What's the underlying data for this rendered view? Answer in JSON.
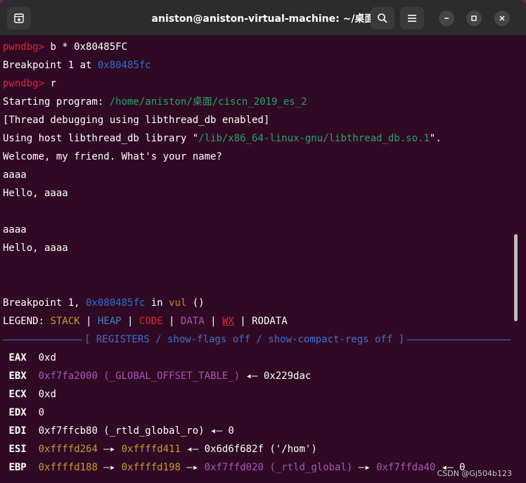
{
  "titlebar": {
    "title": "aniston@aniston-virtual-machine: ~/桌面"
  },
  "icons": {
    "new_tab": "new-tab-icon",
    "search": "search-icon",
    "menu": "hamburger-menu-icon",
    "minimize": "minimize-icon",
    "maximize": "maximize-icon",
    "close": "close-icon"
  },
  "lines": {
    "l1_prompt": "pwndbg>",
    "l1_cmd": " b * 0x80485FC",
    "l2_text": "Breakpoint 1 at ",
    "l2_addr": "0x80485fc",
    "l3_prompt": "pwndbg>",
    "l3_cmd": " r",
    "l4_text": "Starting program: ",
    "l4_path": "/home/aniston/桌面/ciscn_2019_es_2",
    "l5": "[Thread debugging using libthread_db enabled]",
    "l6_text": "Using host libthread_db library \"",
    "l6_path": "/lib/x86_64-linux-gnu/libthread_db.so.1",
    "l6_end": "\".",
    "l7": "Welcome, my friend. What's your name?",
    "l8": "aaaa",
    "l9": "Hello, aaaa",
    "l10": "",
    "l11": "aaaa",
    "l12": "Hello, aaaa",
    "l13": "",
    "l14": "",
    "l15_text": "Breakpoint 1, ",
    "l15_addr": "0x080485fc",
    "l15_in": " in ",
    "l15_func": "vul",
    "l15_end": " ()"
  },
  "legend": {
    "label": "LEGEND: ",
    "stack": "STACK",
    "heap": "HEAP",
    "code": "CODE",
    "data": "DATA",
    "wx": "WX",
    "rodata": "RODATA",
    "sep": " | "
  },
  "section": {
    "title": "[ REGISTERS / show-flags off / show-compact-regs off ]"
  },
  "registers": {
    "eax": {
      "name": "EAX",
      "value": "0xd"
    },
    "ebx": {
      "name": "EBX",
      "value": "0xf7fa2000 (_GLOBAL_OFFSET_TABLE_)",
      "arrow": " ◂— ",
      "target": "0x229dac"
    },
    "ecx": {
      "name": "ECX",
      "value": "0xd"
    },
    "edx": {
      "name": "EDX",
      "value": "0"
    },
    "edi": {
      "name": "EDI",
      "value": "0xf7ffcb80 (_rtld_global_ro)",
      "arrow": " ◂— ",
      "target": "0"
    },
    "esi": {
      "name": "ESI",
      "v1": "0xffffd264",
      "a1": " —▸ ",
      "v2": "0xffffd411",
      "a2": " ◂— ",
      "v3": "0x6d6f682f ('/hom')"
    },
    "ebp": {
      "name": "EBP",
      "v1": "0xffffd188",
      "a1": " —▸ ",
      "v2": "0xffffd198",
      "a2": " —▸ ",
      "v3": "0xf7ffd020 (_rtld_global)",
      "a3": " —▸ ",
      "v4": "0xf7ffda40",
      "a4": " ◂— ",
      "v5": "0"
    }
  },
  "watermark": "CSDN @Gj504b123"
}
